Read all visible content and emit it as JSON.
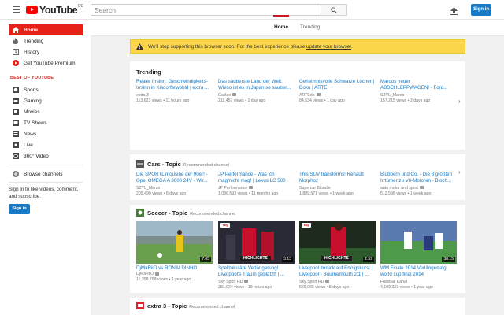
{
  "header": {
    "logo_text": "YouTube",
    "region": "DE",
    "search_placeholder": "Search",
    "signin_label": "Sign in"
  },
  "sidebar": {
    "items": [
      {
        "label": "Home",
        "icon": "home-icon",
        "active": true
      },
      {
        "label": "Trending",
        "icon": "flame-icon"
      },
      {
        "label": "History",
        "icon": "history-icon"
      },
      {
        "label": "Get YouTube Premium",
        "icon": "youtube-icon"
      }
    ],
    "best_heading": "BEST OF YOUTUBE",
    "best_items": [
      {
        "label": "Sports",
        "icon": "sports-icon"
      },
      {
        "label": "Gaming",
        "icon": "gaming-icon"
      },
      {
        "label": "Movies",
        "icon": "movies-icon"
      },
      {
        "label": "TV Shows",
        "icon": "tv-icon"
      },
      {
        "label": "News",
        "icon": "news-icon"
      },
      {
        "label": "Live",
        "icon": "live-icon"
      },
      {
        "label": "360° Video",
        "icon": "360-icon"
      }
    ],
    "browse_label": "Browse channels",
    "signin_message": "Sign in to like videos, comment, and subscribe.",
    "signin_label": "Sign in"
  },
  "tabs": [
    {
      "label": "Home",
      "active": true
    },
    {
      "label": "Trending",
      "active": false
    }
  ],
  "banner": {
    "text": "We'll stop supporting this browser soon. For the best experience please ",
    "link": "update your browser",
    "end": "."
  },
  "trending": {
    "title": "Trending",
    "videos": [
      {
        "title": "Realer Irrsinn: Geschwindigkeits-Irrsinn in Kisdorferwohld | extra ...",
        "channel": "extra 3",
        "views": "113,623 views",
        "age": "11 hours ago"
      },
      {
        "title": "Das sauberste Land der Welt: Wieso ist es in Japan so sauber...",
        "channel": "Galileo",
        "views": "211,457 views",
        "age": "1 day ago"
      },
      {
        "title": "Geheimnisvolle Schwarze Löcher | Doku | ARTE",
        "channel": "ARTEde",
        "views": "84,534 views",
        "age": "1 day ago"
      },
      {
        "title": "Marcos neuer ABSCHLEPPWAGEN! - Ford...",
        "channel": "SZYL_Marco",
        "views": "157,215 views",
        "age": "2 days ago"
      }
    ]
  },
  "cars": {
    "title": "Cars - Topic",
    "subtitle": "Recommended channel",
    "videos": [
      {
        "title": "Die SPORTLimousine der 90er! - Opel OMEGA A 3000 24V - Wir...",
        "channel": "SZYL_Marco",
        "views": "209,499 views",
        "age": "6 days ago"
      },
      {
        "title": "JP Performance - Was ich mag/nicht mag! | Lexus LC 500",
        "channel": "JP Performance",
        "views": "1,036,593 views",
        "age": "11 months ago"
      },
      {
        "title": "This SUV transforms! Renault Morphoz",
        "channel": "Supercar Blondie",
        "views": "1,889,571 views",
        "age": "1 week ago"
      },
      {
        "title": "Blubbern und Co. - Die 8 größten Irrtümer zu V8-Motoren - Bloch...",
        "channel": "auto motor und sport",
        "views": "512,596 views",
        "age": "1 week ago"
      }
    ]
  },
  "soccer": {
    "title": "Soccer - Topic",
    "subtitle": "Recommended channel",
    "videos": [
      {
        "title": "DjMaRiiO vs RONALDINHO",
        "channel": "DjMaRiiO",
        "views": "11,398,768 views",
        "age": "1 year ago",
        "duration": "7:05"
      },
      {
        "title": "Spektakuläre Verlängerung! Liverpool's Traum geplatzt! | ...",
        "channel": "Sky Sport HD",
        "views": "281,934 views",
        "age": "19 hours ago",
        "duration": "3:13",
        "badge": "HIGHLIGHTS",
        "logo": "sky"
      },
      {
        "title": "Liverpool zurück auf Erfolgskurs! | Liverpool - Bournemouth 2:1 | ...",
        "channel": "Sky Sport HD",
        "views": "529,065 views",
        "age": "5 days ago",
        "duration": "2:59",
        "badge": "HIGHLIGHTS",
        "logo": "sky"
      },
      {
        "title": "WM Finale 2014 Verlängerung world cup final 2014",
        "channel": "Fussball Kanal",
        "views": "4,109,323 views",
        "age": "1 year ago",
        "duration": "38:15"
      }
    ]
  },
  "extra3": {
    "title": "extra 3 - Topic",
    "subtitle": "Recommended channel"
  },
  "colors": {
    "accent": "#e62117",
    "link": "#167ac6",
    "banner": "#fcd64a"
  }
}
